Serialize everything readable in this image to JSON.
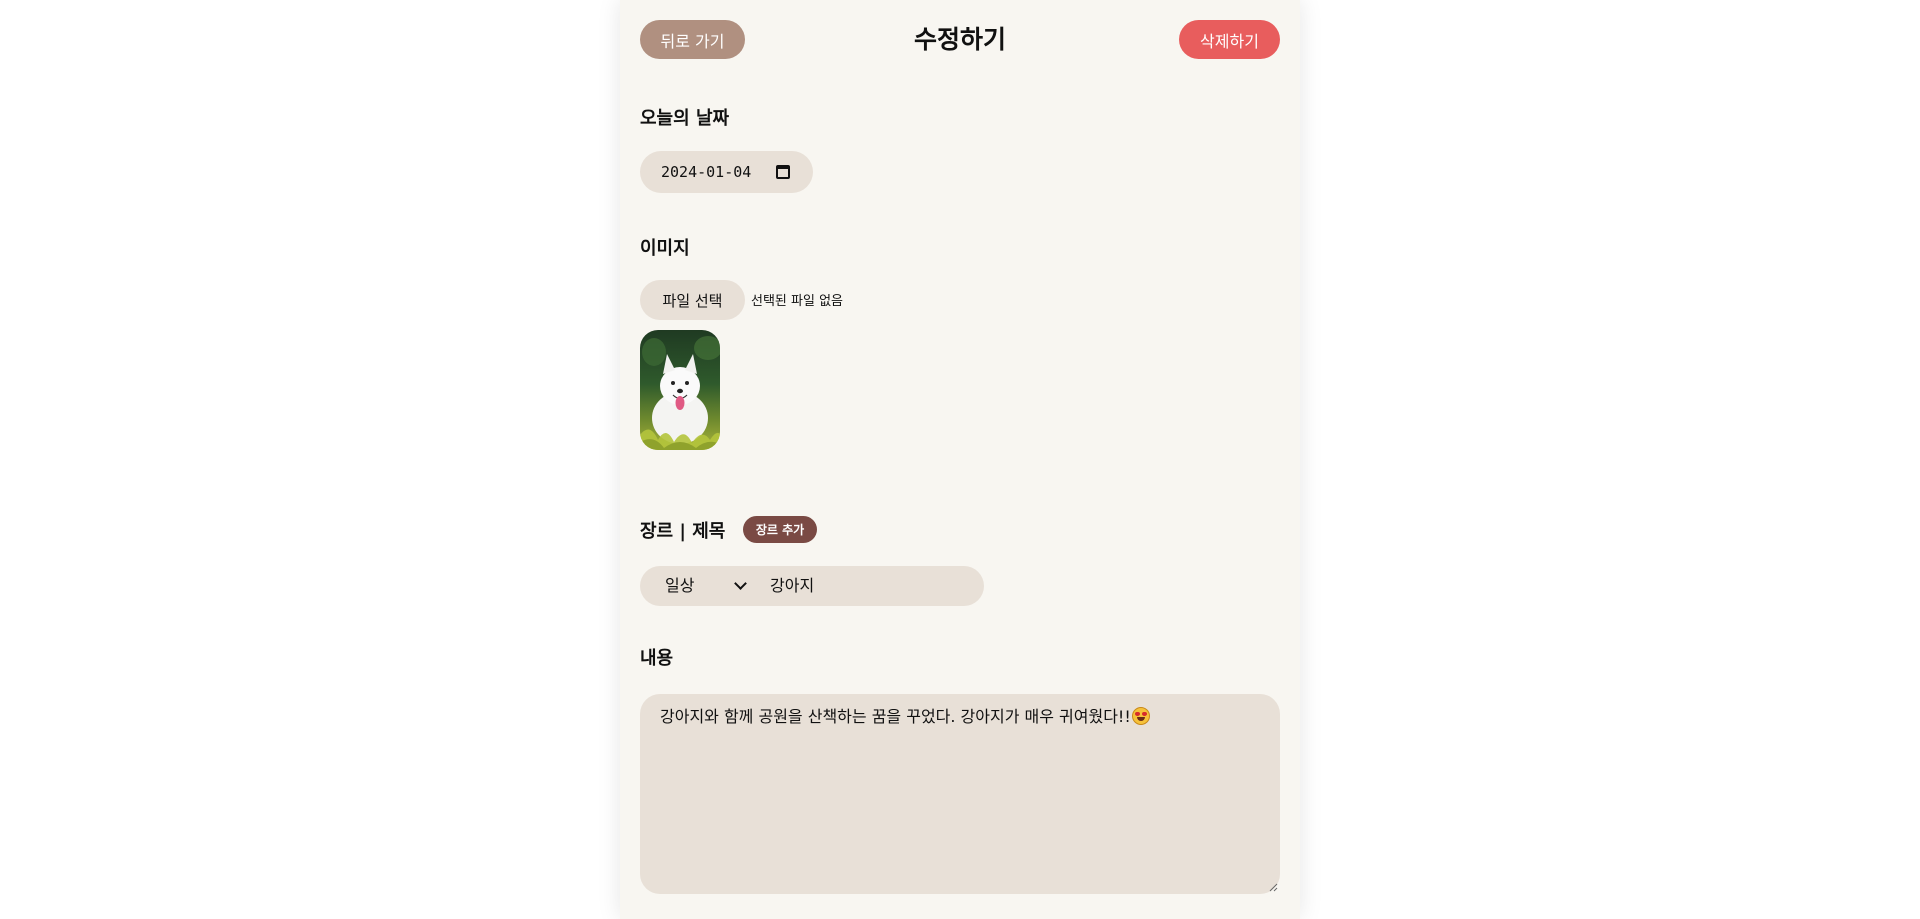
{
  "header": {
    "back_label": "뒤로 가기",
    "title": "수정하기",
    "delete_label": "삭제하기"
  },
  "date_section": {
    "label": "오늘의 날짜",
    "value": "2024-01-04",
    "icon": "calendar-icon"
  },
  "image_section": {
    "label": "이미지",
    "file_button_label": "파일 선택",
    "file_status": "선택된 파일 없음",
    "preview_subject": "samoyed dog photo"
  },
  "genre_section": {
    "label": "장르 | 제목",
    "add_button_label": "장르 추가",
    "selected_genre": "일상",
    "title_value": "강아지"
  },
  "content_section": {
    "label": "내용",
    "text": "강아지와 함께 공원을 산책하는 꿈을 꾸었다. 강아지가 매우 귀여웠다!!",
    "emoji": "star-struck-emoji-icon"
  },
  "colors": {
    "page_background": "#f8f6f1",
    "input_background": "#e8e0d7",
    "back_button": "#b09080",
    "delete_button": "#e85d5d",
    "add_genre_button": "#7a4a44"
  }
}
